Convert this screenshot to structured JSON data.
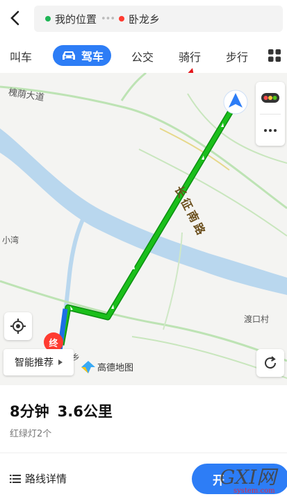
{
  "route": {
    "origin": "我的位置",
    "destination": "卧龙乡"
  },
  "tabs": [
    {
      "label": "叫车"
    },
    {
      "label": "驾车",
      "active": true
    },
    {
      "label": "公交"
    },
    {
      "label": "骑行"
    },
    {
      "label": "步行"
    }
  ],
  "map": {
    "labels": {
      "road_top": "槐荫大道",
      "left_place": "小湾",
      "right_place": "渡口村",
      "main_road": "长征南路",
      "truncated_place": "乡"
    },
    "end_marker": "终",
    "smart_recommend": "智能推荐",
    "logo": "高德地图",
    "route_color": "#1bbf1b",
    "accent": "#2d7df6"
  },
  "summary": {
    "duration": "8分钟",
    "distance": "3.6公里",
    "traffic_lights": "红绿灯2个"
  },
  "actions": {
    "details": "路线详情",
    "start": "开"
  },
  "watermark": {
    "brand": "GXI网",
    "site": "system.com"
  }
}
